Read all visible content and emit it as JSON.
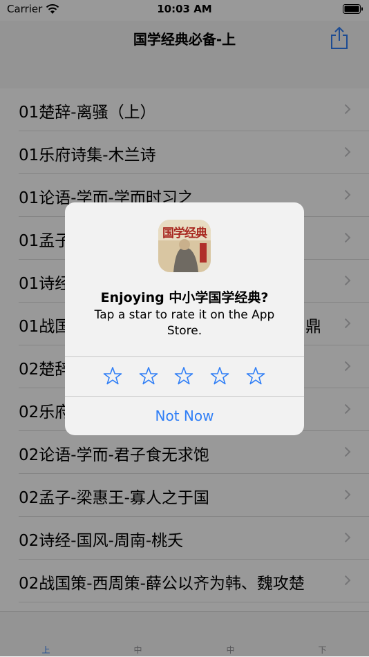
{
  "status_bar": {
    "carrier": "Carrier",
    "time": "10:03 AM"
  },
  "nav": {
    "title": "国学经典必备-上",
    "share_icon": "share-icon"
  },
  "list": [
    "01楚辞-离骚（上）",
    "01乐府诗集-木兰诗",
    "01论语-学而-学而时习之",
    "01孟子",
    "01诗经",
    "01战国",
    "02楚辞",
    "02乐府",
    "02论语-学而-君子食无求饱",
    "02孟子-梁惠王-寡人之于国",
    "02诗经-国风-周南-桃夭",
    "02战国策-西周策-薛公以齐为韩、魏攻楚"
  ],
  "row_tail_fragments": {
    "row5": "鼎"
  },
  "tabs": [
    {
      "label": "上",
      "active": true
    },
    {
      "label": "中",
      "active": false
    },
    {
      "label": "中",
      "active": false
    },
    {
      "label": "下",
      "active": false
    }
  ],
  "alert": {
    "app_icon_text": "国学经典",
    "title": "Enjoying 中小学国学经典?",
    "message": "Tap a star to rate it on the App Store.",
    "star_count": 5,
    "dismiss": "Not Now"
  },
  "colors": {
    "accent": "#2f7ef6",
    "chevron": "#c4c4c6"
  }
}
